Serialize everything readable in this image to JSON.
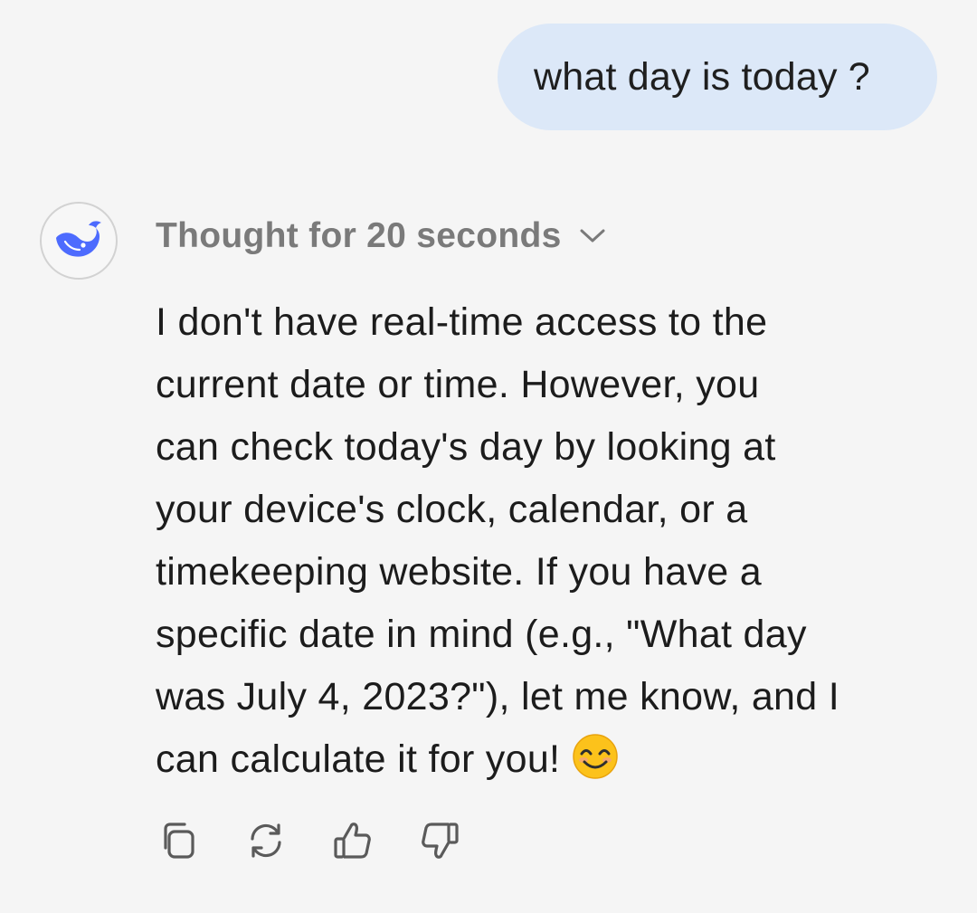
{
  "user_message": {
    "text": "what day is today ?"
  },
  "assistant": {
    "avatar_icon": "whale-logo-icon",
    "brand_color": "#4d6bfe",
    "thought_label": "Thought for 20 seconds",
    "answer_lines": [
      "I don't have real-time access to the",
      "current date or time. However, you",
      "can check today's day by looking at",
      "your device's clock, calendar, or a",
      "timekeeping website. If you have a",
      "specific date in mind (e.g., \"What day",
      "was July 4, 2023?\"), let me know, and I",
      "can calculate it for you!"
    ],
    "trailing_emoji": "smiling-face-emoji",
    "actions": [
      {
        "icon": "copy-icon"
      },
      {
        "icon": "regenerate-icon"
      },
      {
        "icon": "thumbs-up-icon"
      },
      {
        "icon": "thumbs-down-icon"
      }
    ]
  }
}
